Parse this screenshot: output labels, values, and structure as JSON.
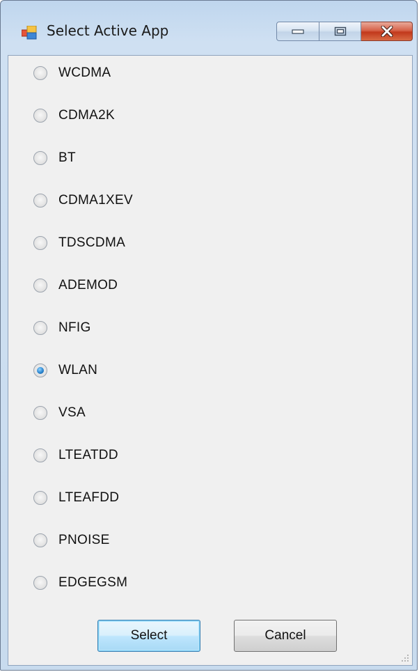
{
  "window": {
    "title": "Select Active App"
  },
  "options": [
    {
      "label": "WCDMA",
      "checked": false
    },
    {
      "label": "CDMA2K",
      "checked": false
    },
    {
      "label": "BT",
      "checked": false
    },
    {
      "label": "CDMA1XEV",
      "checked": false
    },
    {
      "label": "TDSCDMA",
      "checked": false
    },
    {
      "label": "ADEMOD",
      "checked": false
    },
    {
      "label": "NFIG",
      "checked": false
    },
    {
      "label": "WLAN",
      "checked": true
    },
    {
      "label": "VSA",
      "checked": false
    },
    {
      "label": "LTEATDD",
      "checked": false
    },
    {
      "label": "LTEAFDD",
      "checked": false
    },
    {
      "label": "PNOISE",
      "checked": false
    },
    {
      "label": "EDGEGSM",
      "checked": false
    }
  ],
  "buttons": {
    "select_label": "Select",
    "cancel_label": "Cancel"
  },
  "icons": {
    "app": "app-window-icon",
    "minimize": "minimize-icon",
    "maximize": "maximize-icon",
    "close": "close-icon",
    "resize": "resize-grip-icon"
  },
  "colors": {
    "title_gradient": "#c8dbee",
    "client_bg": "#f0f0f0",
    "close_button": "#c2391c",
    "radio_selected": "#2b86d0"
  }
}
